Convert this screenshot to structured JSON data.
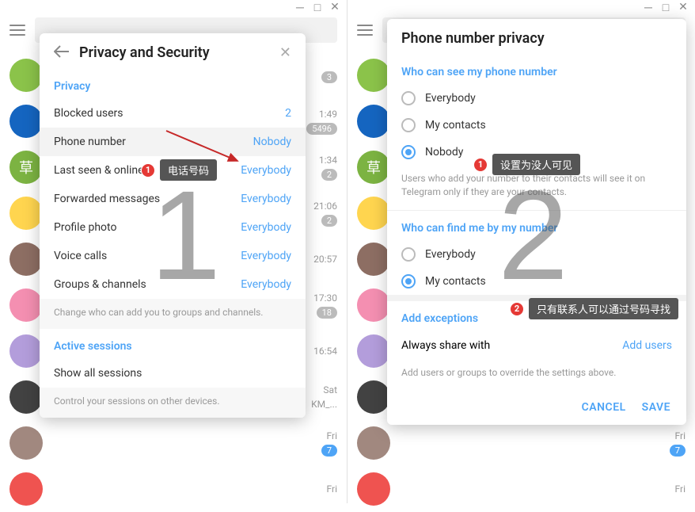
{
  "left": {
    "modal_title": "Privacy and Security",
    "section_privacy": "Privacy",
    "rows": {
      "blocked": {
        "label": "Blocked users",
        "value": "2"
      },
      "phone": {
        "label": "Phone number",
        "value": "Nobody"
      },
      "lastseen": {
        "label": "Last seen & online",
        "value": "Everybody"
      },
      "forwarded": {
        "label": "Forwarded messages",
        "value": "Everybody"
      },
      "photo": {
        "label": "Profile photo",
        "value": "Everybody"
      },
      "calls": {
        "label": "Voice calls",
        "value": "Everybody"
      },
      "groups": {
        "label": "Groups & channels",
        "value": "Everybody"
      }
    },
    "help_groups": "Change who can add you to groups and channels.",
    "section_sessions": "Active sessions",
    "show_all": "Show all sessions",
    "help_sessions": "Control your sessions on other devices.",
    "annot1_num": "1",
    "annot1_tip": "电话号码",
    "big_number": "1"
  },
  "right": {
    "modal_title": "Phone number privacy",
    "section_see": "Who can see my phone number",
    "opt_everybody": "Everybody",
    "opt_mycontacts": "My contacts",
    "opt_nobody": "Nobody",
    "hint_see": "Users who add your number to their contacts will see it on Telegram only if they are your contacts.",
    "section_find": "Who can find me by my number",
    "section_exceptions": "Add exceptions",
    "always_share": "Always share with",
    "add_users": "Add users",
    "hint_exc": "Add users or groups to override the settings above.",
    "btn_cancel": "CANCEL",
    "btn_save": "SAVE",
    "annot1_num": "1",
    "annot1_tip": "设置为没人可见",
    "annot2_num": "2",
    "annot2_tip": "只有联系人可以通过号码寻找",
    "big_number": "2"
  },
  "bg_chats": [
    {
      "color": "#8bc34a",
      "time": "",
      "badge": "3"
    },
    {
      "color": "#1565c0",
      "time": "1:49",
      "badge": "5496"
    },
    {
      "color": "#7cb342",
      "time": "1:34",
      "badge": "2",
      "letter": "草"
    },
    {
      "color": "#ffd54f",
      "time": "21:06",
      "badge": "2"
    },
    {
      "color": "#8d6e63",
      "time": "20:57",
      "badge": ""
    },
    {
      "color": "#f48fb1",
      "time": "17:30",
      "badge": "18"
    },
    {
      "color": "#b39ddb",
      "time": "16:54",
      "badge": ""
    },
    {
      "color": "#424242",
      "time": "Sat",
      "badge": "",
      "sub": "KM_..."
    },
    {
      "color": "#a1887f",
      "time": "Fri",
      "badge": "7",
      "blue": true
    },
    {
      "color": "#ef5350",
      "time": "Fri",
      "badge": ""
    }
  ]
}
